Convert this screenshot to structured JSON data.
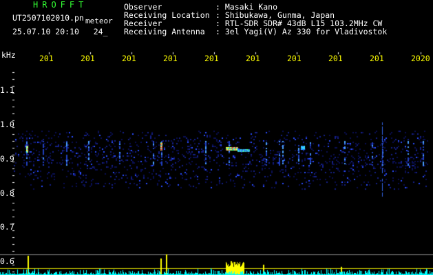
{
  "header": {
    "title": "HROFFT",
    "filename": "UT2507102010.pn",
    "mode": "meteor",
    "datetime": "25.07.10 20:10",
    "extra": "24_"
  },
  "info": [
    {
      "label": "Observer",
      "value": ": Masaki Kano"
    },
    {
      "label": "Receiving Location",
      "value": ": Shibukawa, Gunma, Japan"
    },
    {
      "label": "Receiver",
      "value": ": RTL-SDR SDR# 43dB L15 103.2MHz CW"
    },
    {
      "label": "Receiving Antenna",
      "value": ": 3el Yagi(V) Az 330 for Vladivostok"
    }
  ],
  "axis": {
    "unit": "kHz",
    "time_labels": [
      "201",
      "201",
      "201",
      "201",
      "201",
      "201",
      "201",
      "201",
      "201",
      "2020"
    ],
    "freq_labels": [
      "1.1",
      "1.0",
      "0.9",
      "0.8",
      "0.7",
      "0.6"
    ]
  },
  "colors": {
    "title": "#33ff33",
    "text": "#ffff00",
    "label": "#ffffff",
    "background": "#000000"
  }
}
